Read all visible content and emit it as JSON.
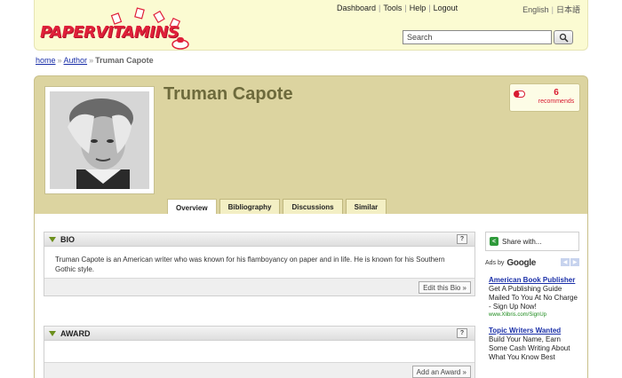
{
  "header": {
    "logo_text": "PAPERVITAMINS",
    "nav": [
      "Dashboard",
      "Tools",
      "Help",
      "Logout"
    ],
    "languages": [
      "English",
      "日本語"
    ],
    "search_placeholder": "Search"
  },
  "breadcrumb": {
    "home": "home",
    "author": "Author",
    "current": "Truman Capote"
  },
  "profile": {
    "name": "Truman Capote",
    "recommend_count": "6",
    "recommend_label": "recommends"
  },
  "tabs": [
    "Overview",
    "Bibliography",
    "Discussions",
    "Similar"
  ],
  "bio": {
    "title": "BIO",
    "help": "?",
    "text": "Truman Capote is an American writer who was known for his flamboyancy on paper and in life. He is known for his Southern Gothic style.",
    "action": "Edit this Bio »"
  },
  "award": {
    "title": "AWARD",
    "help": "?",
    "action": "Add an Award »"
  },
  "sidebar": {
    "share": "Share with...",
    "ads_by": "Ads by",
    "google": "Google",
    "ads": [
      {
        "title": "American Book Publisher",
        "text": "Get A Publishing Guide Mailed To You At No Charge - Sign Up Now!",
        "url": "www.Xlibris.com/SignUp"
      },
      {
        "title": "Topic Writers Wanted",
        "text": "Build Your Name, Earn Some Cash Writing About What You Know Best",
        "url": ""
      }
    ]
  },
  "colors": {
    "accent": "#e0203a",
    "profile_band": "#dcd4a0",
    "header_bg": "#fbfbd2",
    "link": "#1a2fa8"
  }
}
